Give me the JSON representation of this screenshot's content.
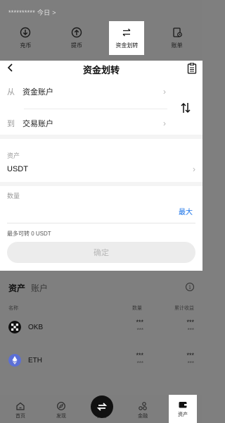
{
  "top": {
    "account_line": "********** 今日 >",
    "actions": [
      {
        "label": "充币",
        "icon": "deposit-icon"
      },
      {
        "label": "提币",
        "icon": "withdraw-icon"
      },
      {
        "label": "资金划转",
        "icon": "transfer-icon",
        "active": true
      },
      {
        "label": "账单",
        "icon": "bill-icon"
      }
    ]
  },
  "transfer": {
    "title": "资金划转",
    "from_key": "从",
    "from_value": "资金账户",
    "to_key": "到",
    "to_value": "交易账户",
    "asset_label": "资产",
    "asset_value": "USDT",
    "quantity_label": "数量",
    "max_label": "最大",
    "available_text": "最多可转 0 USDT",
    "confirm_label": "确定"
  },
  "assets": {
    "tab_assets": "资产",
    "tab_accounts": "账户",
    "info_glyph": "i",
    "col_name": "名称",
    "col_qty": "数量",
    "col_pnl": "累计收益",
    "coins": [
      {
        "symbol": "OKB",
        "qty": "***",
        "qty_sub": "***",
        "pnl": "***",
        "pnl_sub": "***"
      },
      {
        "symbol": "ETH",
        "qty": "***",
        "qty_sub": "***",
        "pnl": "***",
        "pnl_sub": "***"
      }
    ]
  },
  "nav": {
    "items": [
      {
        "label": "首页",
        "icon": "home-icon"
      },
      {
        "label": "发现",
        "icon": "discover-icon"
      },
      {
        "label": "交易",
        "icon": "trade-icon"
      },
      {
        "label": "金融",
        "icon": "finance-icon"
      },
      {
        "label": "资产",
        "icon": "wallet-icon",
        "active": true
      }
    ]
  },
  "colors": {
    "accent_blue": "#1a73e8",
    "dim_overlay": "#7f7f7f"
  }
}
